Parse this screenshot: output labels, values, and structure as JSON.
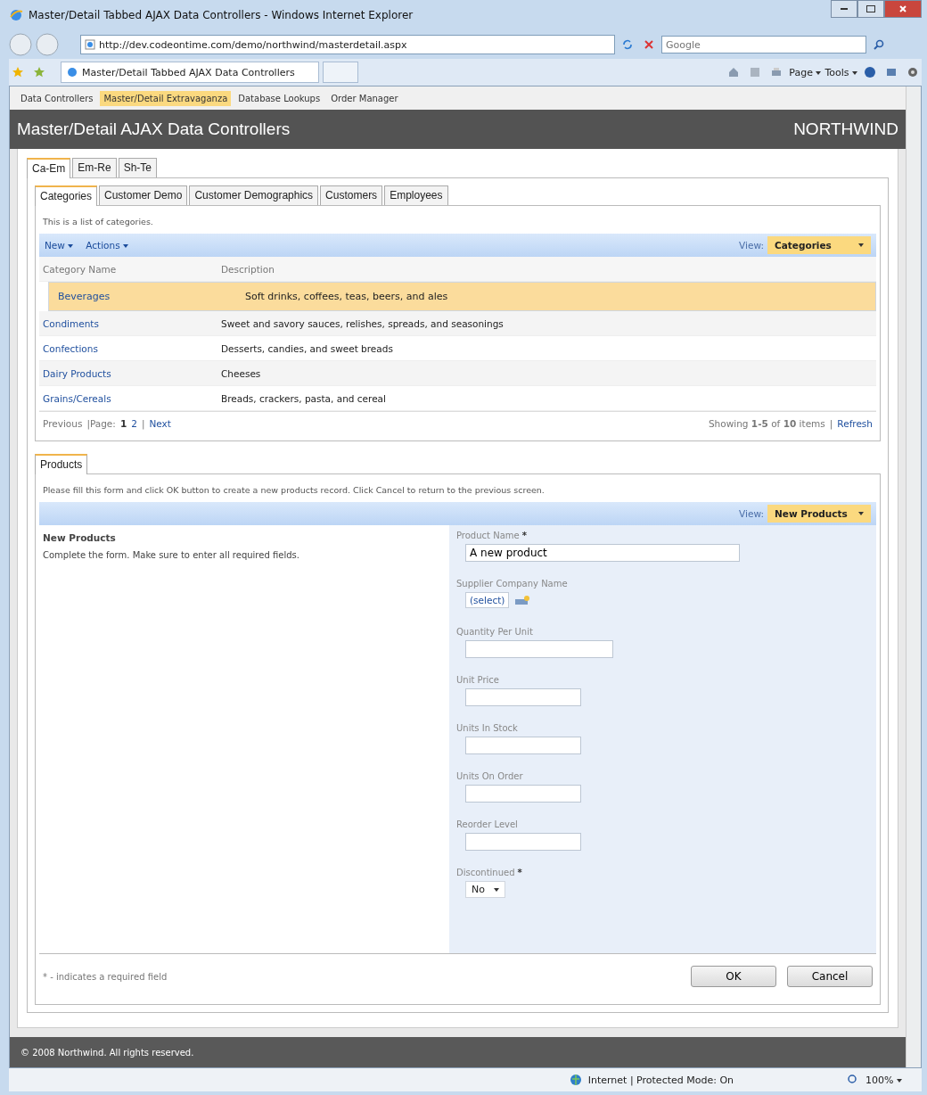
{
  "window": {
    "title": "Master/Detail Tabbed AJAX Data Controllers - Windows Internet Explorer"
  },
  "address_bar": {
    "url": "http://dev.codeontime.com/demo/northwind/masterdetail.aspx"
  },
  "search": {
    "placeholder": "Google"
  },
  "toolbar": {
    "tab_title": "Master/Detail Tabbed AJAX Data Controllers",
    "commands": [
      "Page",
      "Tools"
    ]
  },
  "menu": [
    {
      "label": "Data Controllers",
      "selected": false
    },
    {
      "label": "Master/Detail Extravaganza",
      "selected": true
    },
    {
      "label": "Database Lookups",
      "selected": false
    },
    {
      "label": "Order Manager",
      "selected": false
    }
  ],
  "header": {
    "title": "Master/Detail AJAX Data Controllers",
    "brand": "NORTHWIND"
  },
  "group_tabs": [
    {
      "label": "Ca-Em",
      "selected": true
    },
    {
      "label": "Em-Re",
      "selected": false
    },
    {
      "label": "Sh-Te",
      "selected": false
    }
  ],
  "tabs": [
    {
      "label": "Categories",
      "selected": true
    },
    {
      "label": "Customer Demo",
      "selected": false
    },
    {
      "label": "Customer Demographics",
      "selected": false
    },
    {
      "label": "Customers",
      "selected": false
    },
    {
      "label": "Employees",
      "selected": false
    }
  ],
  "list": {
    "description": "This is a list of categories.",
    "actions": [
      "New",
      "Actions"
    ],
    "view_label": "View:",
    "view": "Categories",
    "columns": [
      "Category Name",
      "Description"
    ],
    "rows": [
      {
        "name": "Beverages",
        "description": "Soft drinks, coffees, teas, beers, and ales",
        "selected": true
      },
      {
        "name": "Condiments",
        "description": "Sweet and savory sauces, relishes, spreads, and seasonings",
        "selected": false
      },
      {
        "name": "Confections",
        "description": "Desserts, candies, and sweet breads",
        "selected": false
      },
      {
        "name": "Dairy Products",
        "description": "Cheeses",
        "selected": false
      },
      {
        "name": "Grains/Cereals",
        "description": "Breads, crackers, pasta, and cereal",
        "selected": false
      }
    ],
    "pager": {
      "previous": "Previous",
      "page_label": "|Page:",
      "pages": [
        {
          "label": "1",
          "selected": true
        },
        {
          "label": "2",
          "selected": false
        }
      ],
      "separator": "|",
      "next": "Next",
      "showing": "Showing **1-5** of **10** items",
      "refresh_separator": "|",
      "refresh": "Refresh"
    }
  },
  "detail_tabs": [
    {
      "label": "Products",
      "selected": true
    }
  ],
  "form": {
    "instruction": "Please fill this form and click OK button to create a new products record. Click Cancel to return to the previous screen.",
    "view_label": "View:",
    "view": "New Products",
    "title": "New Products",
    "subtitle": "Complete the form. Make sure to enter all required fields.",
    "fields": [
      {
        "label": "Product Name",
        "required": true,
        "kind": "longtext",
        "value": "A new product"
      },
      {
        "label": "Supplier Company Name",
        "required": false,
        "kind": "lookup",
        "value": "(select)"
      },
      {
        "label": "Quantity Per Unit",
        "required": false,
        "kind": "mediumtext"
      },
      {
        "label": "Unit Price",
        "required": false,
        "kind": "shorttext"
      },
      {
        "label": "Units In Stock",
        "required": false,
        "kind": "shorttext"
      },
      {
        "label": "Units On Order",
        "required": false,
        "kind": "shorttext"
      },
      {
        "label": "Reorder Level",
        "required": false,
        "kind": "shorttext"
      },
      {
        "label": "Discontinued",
        "required": true,
        "kind": "select",
        "value": "No"
      }
    ],
    "required_mark": "*",
    "footnote": "* - indicates a required field",
    "buttons": [
      "OK",
      "Cancel"
    ]
  },
  "footer": {
    "copyright": "© 2008 Northwind. All rights reserved."
  },
  "status_bar": {
    "zone": "Internet | Protected Mode: On",
    "zoom": "100%"
  }
}
